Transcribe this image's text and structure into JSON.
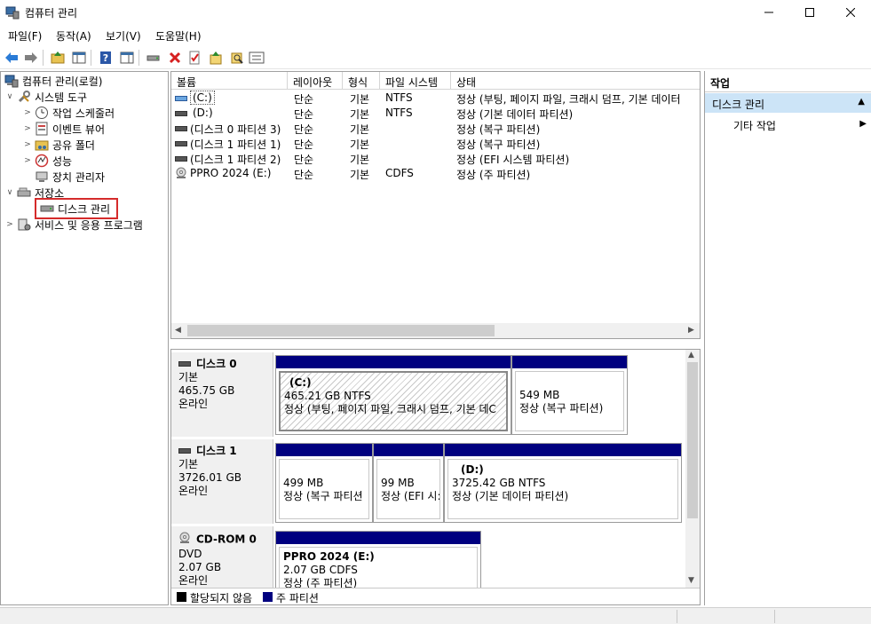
{
  "window": {
    "title": "컴퓨터 관리"
  },
  "menu": {
    "items": [
      "파일(F)",
      "동작(A)",
      "보기(V)",
      "도움말(H)"
    ]
  },
  "tree": {
    "root": "컴퓨터 관리(로컬)",
    "system_tools": "시스템 도구",
    "task_scheduler": "작업 스케줄러",
    "event_viewer": "이벤트 뷰어",
    "shared_folders": "공유 폴더",
    "performance": "성능",
    "device_manager": "장치 관리자",
    "storage": "저장소",
    "disk_management": "디스크 관리",
    "services_apps": "서비스 및 응용 프로그램"
  },
  "volumes": {
    "columns": [
      "볼륨",
      "레이아웃",
      "형식",
      "파일 시스템",
      "상태"
    ],
    "rows": [
      {
        "volume": "(C:)",
        "layout": "단순",
        "type": "기본",
        "fs": "NTFS",
        "status": "정상 (부팅, 페이지 파일, 크래시 덤프, 기본 데이터"
      },
      {
        "volume": "(D:)",
        "layout": "단순",
        "type": "기본",
        "fs": "NTFS",
        "status": "정상 (기본 데이터 파티션)"
      },
      {
        "volume": "(디스크 0 파티션 3)",
        "layout": "단순",
        "type": "기본",
        "fs": "",
        "status": "정상 (복구 파티션)"
      },
      {
        "volume": "(디스크 1 파티션 1)",
        "layout": "단순",
        "type": "기본",
        "fs": "",
        "status": "정상 (복구 파티션)"
      },
      {
        "volume": "(디스크 1 파티션 2)",
        "layout": "단순",
        "type": "기본",
        "fs": "",
        "status": "정상 (EFI 시스템 파티션)"
      },
      {
        "volume": "PPRO 2024 (E:)",
        "layout": "단순",
        "type": "기본",
        "fs": "CDFS",
        "status": "정상 (주 파티션)"
      }
    ]
  },
  "disks": {
    "disk0": {
      "name": "디스크 0",
      "type": "기본",
      "size": "465.75 GB",
      "state": "온라인",
      "parts": [
        {
          "title": "(C:)",
          "size": "465.21 GB NTFS",
          "status": "정상 (부팅, 페이지 파일, 크래시 덤프, 기본 데C"
        },
        {
          "title": "",
          "size": "549 MB",
          "status": "정상 (복구 파티션)"
        }
      ]
    },
    "disk1": {
      "name": "디스크 1",
      "type": "기본",
      "size": "3726.01 GB",
      "state": "온라인",
      "parts": [
        {
          "title": "",
          "size": "499 MB",
          "status": "정상 (복구 파티션"
        },
        {
          "title": "",
          "size": "99 MB",
          "status": "정상 (EFI 시:"
        },
        {
          "title": "(D:)",
          "size": "3725.42 GB NTFS",
          "status": "정상 (기본 데이터 파티션)"
        }
      ]
    },
    "cdrom0": {
      "name": "CD-ROM 0",
      "type": "DVD",
      "size": "2.07 GB",
      "state": "온라인",
      "parts": [
        {
          "title": "PPRO 2024  (E:)",
          "size": "2.07 GB CDFS",
          "status": "정상 (주 파티션)"
        }
      ]
    }
  },
  "legend": {
    "unallocated": "할당되지 않음",
    "primary": "주 파티션"
  },
  "actions": {
    "header": "작업",
    "section": "디스크 관리",
    "more": "기타 작업"
  },
  "colors": {
    "partition_bar": "#00007f",
    "selection": "#d52b2b",
    "action_section": "#cce4f7"
  }
}
